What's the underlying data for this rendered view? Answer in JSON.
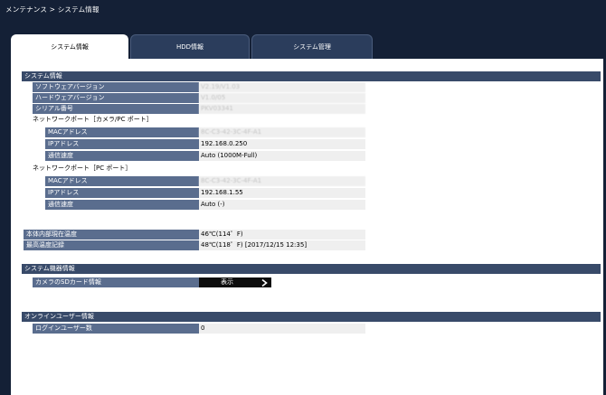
{
  "breadcrumb": "メンテナンス > システム情報",
  "tabs": [
    {
      "label": "システム情報"
    },
    {
      "label": "HDD情報"
    },
    {
      "label": "システム管理"
    }
  ],
  "system_info": {
    "header": "システム情報",
    "software_version": {
      "label": "ソフトウェアバージョン",
      "value": "V2.19/V1.03"
    },
    "hardware_version": {
      "label": "ハードウェアバージョン",
      "value": "V1.0/05"
    },
    "serial_number": {
      "label": "シリアル番号",
      "value": "PKV03341"
    },
    "network_port_camera": {
      "title": "ネットワークポート［カメラ/PC ポート］",
      "mac": {
        "label": "MACアドレス",
        "value": "8C-C3-42-3C-4F-A1"
      },
      "ip": {
        "label": "IPアドレス",
        "value": "192.168.0.250"
      },
      "speed": {
        "label": "通信速度",
        "value": "Auto (1000M-Full)"
      }
    },
    "network_port_pc": {
      "title": "ネットワークポート［PC ポート］",
      "mac": {
        "label": "MACアドレス",
        "value": "8C-C3-42-3C-4F-A1"
      },
      "ip": {
        "label": "IPアドレス",
        "value": "192.168.1.55"
      },
      "speed": {
        "label": "通信速度",
        "value": "Auto (-)"
      }
    },
    "current_temp": {
      "label": "本体内部現在温度",
      "value": "46℃(114゜F)"
    },
    "max_temp": {
      "label": "最高温度記録",
      "value": "48℃(118゜F) [2017/12/15 12:35]"
    }
  },
  "system_device_info": {
    "header": "システム機器情報",
    "sd_card": {
      "label": "カメラのSDカード情報",
      "button_label": "表示"
    }
  },
  "online_user_info": {
    "header": "オンラインユーザー情報",
    "login_users": {
      "label": "ログインユーザー数",
      "value": "0"
    }
  }
}
